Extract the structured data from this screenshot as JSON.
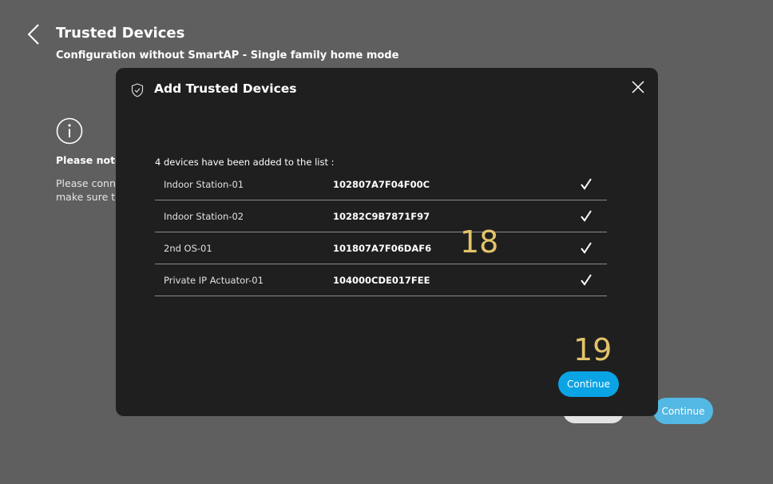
{
  "header": {
    "title": "Trusted Devices",
    "subtitle": "Configuration without SmartAP - Single family home mode"
  },
  "note": {
    "title": "Please note",
    "lines": [
      "Please conn",
      "make sure t"
    ]
  },
  "background_buttons": {
    "continue_label": "Continue"
  },
  "modal": {
    "title": "Add Trusted Devices",
    "caption": "4 devices have been added to the list :",
    "devices": [
      {
        "name": "Indoor Station-01",
        "id": "102807A7F04F00C"
      },
      {
        "name": "Indoor Station-02",
        "id": "10282C9B7871F97"
      },
      {
        "name": "2nd OS-01",
        "id": "101807A7F06DAF6"
      },
      {
        "name": "Private IP Actuator-01",
        "id": "104000CDE017FEE"
      }
    ],
    "continue_label": "Continue"
  },
  "annotations": {
    "marker_a": "18",
    "marker_b": "19"
  },
  "icons": {
    "back": "chevron-left-icon",
    "info": "info-icon",
    "shield": "shield-check-icon",
    "close": "close-icon",
    "check": "check-icon"
  },
  "colors": {
    "page_bg": "#5f5f5f",
    "modal_bg": "#1f1f1f",
    "accent": "#0aa3e4",
    "marker": "#e3c36a"
  }
}
